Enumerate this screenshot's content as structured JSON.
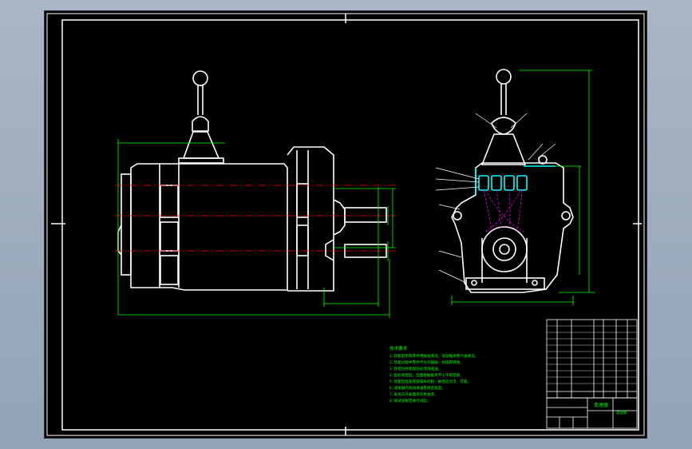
{
  "drawing": {
    "notes_heading": "技术要求",
    "notes": [
      "1.装配前所有零件用煤油清洗，滚动轴承用汽油清洗，",
      "2.装配过程中零件不允许磕碰、划伤和锈蚀。",
      "3.各密封件装配前必须浸透油。",
      "4.齿轮装配后，齿面接触斑点不小于规定值。",
      "5.装配后检查变速操纵机构，换挡应灵活、可靠。",
      "6.减速器内装润滑油至规定高度。",
      "7.未加工外表面涂灰色油漆。",
      "8.按试验规范进行试验。"
    ],
    "title_block": {
      "drawing_title": "变速器",
      "unit_name": "装配图"
    }
  },
  "colors": {
    "background": "#a9b6c6",
    "sheet": "#000000",
    "outline": "#ffffff",
    "dimension": "#00ff00",
    "centerline": "#ff0000",
    "hidden": "#ff00ff",
    "highlight": "#00ffff",
    "notes": "#00ff00"
  }
}
